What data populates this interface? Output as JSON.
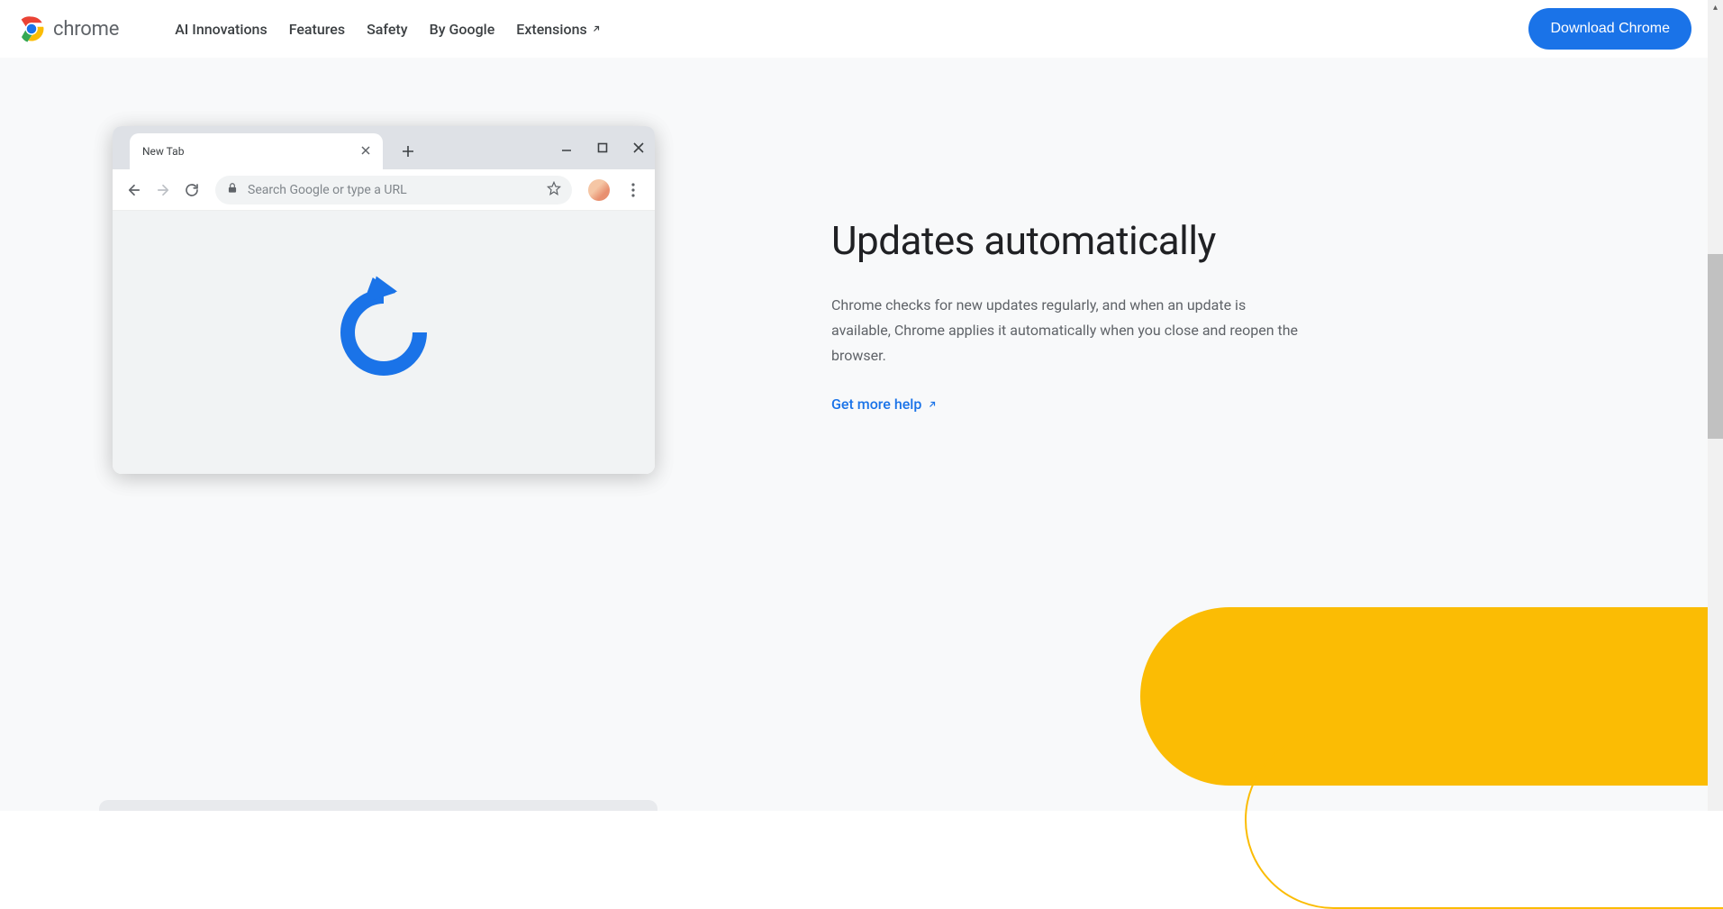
{
  "header": {
    "logo_text": "chrome",
    "nav": {
      "ai": "AI Innovations",
      "features": "Features",
      "safety": "Safety",
      "by_google": "By Google",
      "extensions": "Extensions"
    },
    "download_label": "Download Chrome"
  },
  "browser": {
    "tab_title": "New Tab",
    "omnibox_placeholder": "Search Google or type a URL"
  },
  "section": {
    "heading": "Updates automatically",
    "body": "Chrome checks for new updates regularly, and when an update is available, Chrome applies it automatically when you close and reopen the browser.",
    "link_label": "Get more help"
  },
  "colors": {
    "accent": "#1a73e8",
    "yellow": "#fbbc04"
  }
}
